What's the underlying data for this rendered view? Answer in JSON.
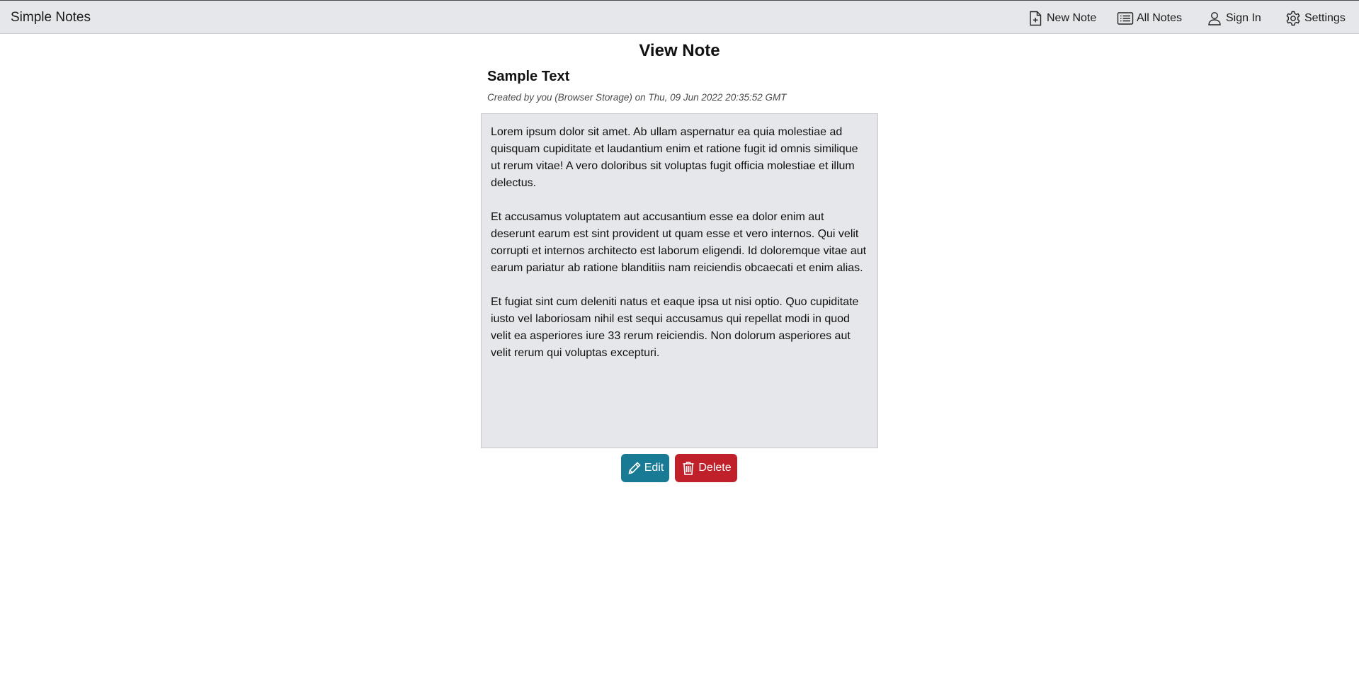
{
  "header": {
    "brand": "Simple Notes",
    "nav": [
      {
        "label": "New Note",
        "icon": "new-note-icon"
      },
      {
        "label": "All Notes",
        "icon": "list-icon"
      },
      {
        "label": "Sign In",
        "icon": "user-icon"
      },
      {
        "label": "Settings",
        "icon": "gear-icon"
      }
    ]
  },
  "page": {
    "title": "View Note"
  },
  "note": {
    "title": "Sample Text",
    "meta": "Created by you (Browser Storage) on Thu, 09 Jun 2022 20:35:52 GMT",
    "paragraphs": [
      "Lorem ipsum dolor sit amet. Ab ullam aspernatur ea quia molestiae ad quisquam cupiditate et laudantium enim et ratione fugit id omnis similique ut rerum vitae! A vero doloribus sit voluptas fugit officia molestiae et illum delectus.",
      "Et accusamus voluptatem aut accusantium esse ea dolor enim aut deserunt earum est sint provident ut quam esse et vero internos. Qui velit corrupti et internos architecto est laborum eligendi. Id doloremque vitae aut earum pariatur ab ratione blanditiis nam reiciendis obcaecati et enim alias.",
      "Et fugiat sint cum deleniti natus et eaque ipsa ut nisi optio. Quo cupiditate iusto vel laboriosam nihil est sequi accusamus qui repellat modi in quod velit ea asperiores iure 33 rerum reiciendis. Non dolorum asperiores aut velit rerum qui voluptas excepturi."
    ]
  },
  "actions": {
    "edit_label": "Edit",
    "delete_label": "Delete"
  },
  "colors": {
    "header_bg": "#e6e7ea",
    "note_bg": "#e6e7ea",
    "edit_button": "#187a94",
    "delete_button": "#c0202a"
  }
}
